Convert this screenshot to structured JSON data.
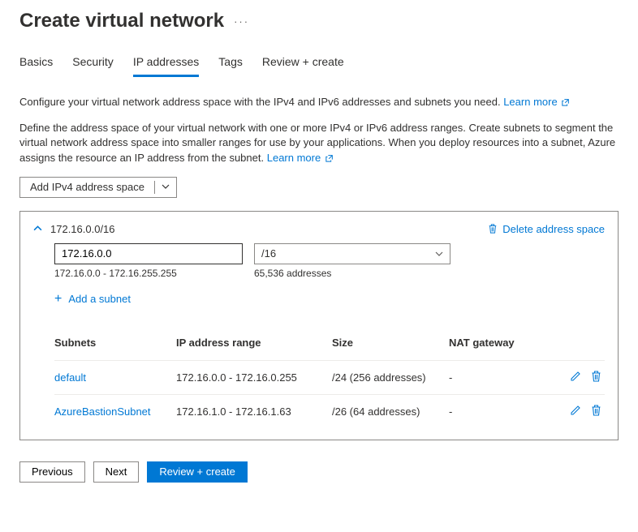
{
  "title": "Create virtual network",
  "tabs": [
    "Basics",
    "Security",
    "IP addresses",
    "Tags",
    "Review + create"
  ],
  "activeTab": 2,
  "intro1": "Configure your virtual network address space with the IPv4 and IPv6 addresses and subnets you need.",
  "intro2": "Define the address space of your virtual network with one or more IPv4 or IPv6 address ranges. Create subnets to segment the virtual network address space into smaller ranges for use by your applications. When you deploy resources into a subnet, Azure assigns the resource an IP address from the subnet.",
  "learn": "Learn more",
  "addSpaceBtn": "Add IPv4 address space",
  "space": {
    "cidr": "172.16.0.0/16",
    "ip": "172.16.0.0",
    "mask": "/16",
    "range": "172.16.0.0 - 172.16.255.255",
    "count": "65,536 addresses"
  },
  "deleteSpace": "Delete address space",
  "addSubnet": "Add a subnet",
  "cols": {
    "name": "Subnets",
    "range": "IP address range",
    "size": "Size",
    "nat": "NAT gateway"
  },
  "subnets": [
    {
      "name": "default",
      "range": "172.16.0.0 - 172.16.0.255",
      "size": "/24 (256 addresses)",
      "nat": "-"
    },
    {
      "name": "AzureBastionSubnet",
      "range": "172.16.1.0 - 172.16.1.63",
      "size": "/26 (64 addresses)",
      "nat": "-"
    }
  ],
  "buttons": {
    "prev": "Previous",
    "next": "Next",
    "review": "Review + create"
  }
}
